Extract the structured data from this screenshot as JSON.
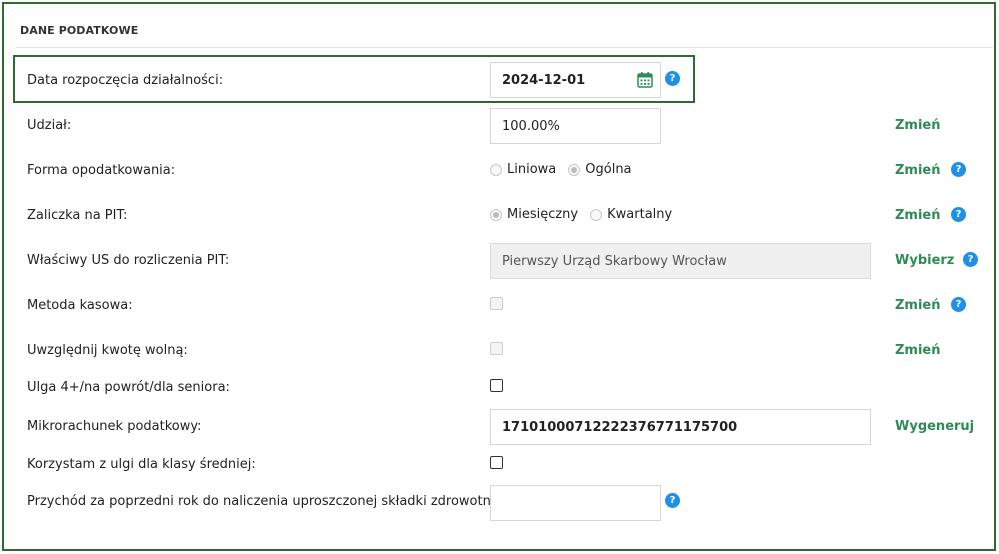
{
  "section": {
    "title": "DANE PODATKOWE"
  },
  "rows": {
    "start_date": {
      "label": "Data rozpoczęcia działalności:",
      "value": "2024-12-01",
      "help": "?"
    },
    "share": {
      "label": "Udział:",
      "value": "100.00%",
      "action": "Zmień"
    },
    "tax_form": {
      "label": "Forma opodatkowania:",
      "options": [
        "Liniowa",
        "Ogólna"
      ],
      "selected": "Ogólna",
      "action": "Zmień",
      "help": "?"
    },
    "pit_advance": {
      "label": "Zaliczka na PIT:",
      "options": [
        "Miesięczny",
        "Kwartalny"
      ],
      "selected": "Miesięczny",
      "action": "Zmień",
      "help": "?"
    },
    "tax_office": {
      "label": "Właściwy US do rozliczenia PIT:",
      "value": "Pierwszy Urząd Skarbowy Wrocław",
      "action": "Wybierz",
      "help": "?"
    },
    "cash_method": {
      "label": "Metoda kasowa:",
      "checked": false,
      "action": "Zmień",
      "help": "?"
    },
    "free_amount": {
      "label": "Uwzględnij kwotę wolną:",
      "checked": false,
      "action": "Zmień"
    },
    "relief_4plus": {
      "label": "Ulga 4+/na powrót/dla seniora:",
      "checked": false
    },
    "micro_account": {
      "label": "Mikrorachunek podatkowy:",
      "value": "17101000712222376771175700",
      "action": "Wygeneruj"
    },
    "middle_class": {
      "label": "Korzystam z ulgi dla klasy średniej:",
      "checked": false
    },
    "prev_income": {
      "label": "Przychód za poprzedni rok do naliczenia uproszczonej składki zdrowotnej:",
      "value": "",
      "help": "?"
    }
  },
  "colors": {
    "frame": "#2d6a2d",
    "link": "#2e8b57",
    "help": "#1e90e8",
    "calendar": "#2e8b57"
  },
  "icons": {
    "calendar": "calendar-icon",
    "help": "help-icon"
  }
}
